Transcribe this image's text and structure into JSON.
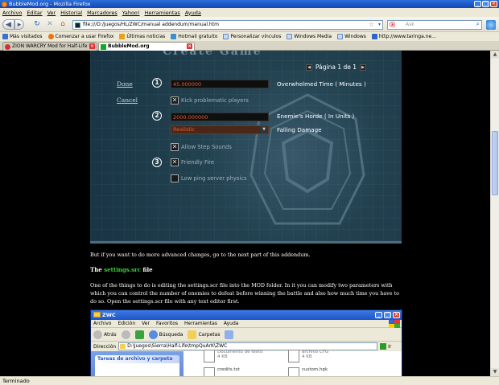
{
  "window": {
    "title": "BubbleMod.org - Mozilla Firefox"
  },
  "menubar": [
    "Archivo",
    "Editar",
    "Ver",
    "Historial",
    "Marcadores",
    "Yahoo!",
    "Herramientas",
    "Ayuda"
  ],
  "navbar": {
    "url": "file:///D:/Juegos/HL/ZWC/manual addendum/manual.htm",
    "search_placeholder": "Ask"
  },
  "bookmarks": [
    {
      "label": "Más visitados",
      "color": "#3b6fd0"
    },
    {
      "label": "Comenzar a usar Firefox",
      "color": "#e8741a"
    },
    {
      "label": "Últimas noticias",
      "color": "#e8a21a"
    },
    {
      "label": "Hotmail gratuito",
      "color": "#3b8fd0"
    },
    {
      "label": "Personalizar vínculos",
      "color": "#5a8ad0"
    },
    {
      "label": "Windows Media",
      "color": "#5a8ad0"
    },
    {
      "label": "Windows",
      "color": "#5a8ad0"
    },
    {
      "label": "http://www.taringa.ne...",
      "color": "#2f66c8"
    }
  ],
  "tabs": [
    {
      "label": "ZION WARCRY Mod for Half-Life E...",
      "active": false
    },
    {
      "label": "BubbleMod.org",
      "active": true
    }
  ],
  "game": {
    "title": "Create Game",
    "page_label": "Página 1 de 1",
    "side_done": "Done",
    "side_cancel": "Cancel",
    "num1": "1",
    "num2": "2",
    "num3": "3",
    "time_value": "45.000000",
    "time_label": "Overwhelmed Time ( Minutes )",
    "kick_label": "Kick problematic players",
    "horde_value": "2000.000000",
    "horde_label": "Enemie's Horde ( In Units )",
    "realism_value": "Realistic",
    "falling_label": "Falling Damage",
    "step_label": "Allow Step Sounds",
    "friendly_label": "Friendly Fire",
    "lowping_label": "Low ping server physics"
  },
  "body": {
    "para1": "But if you want to do more advanced changes, go to the next part of this addendum.",
    "heading_prefix": "The",
    "heading_file": "settings.src",
    "heading_suffix": "file",
    "para2": "One of the things to do is editing the settings.scr file into the MOD folder. In it you can modify two parameters with which you can control the number of enemies to defeat before winning the battle and also how much time you have to do so. Open the settings.scr file with any text editor first."
  },
  "explorer": {
    "title": "ZWC",
    "menu": [
      "Archivo",
      "Edición",
      "Ver",
      "Favoritos",
      "Herramientas",
      "Ayuda"
    ],
    "back": "Atrás",
    "search": "Búsqueda",
    "folders": "Carpetas",
    "address_label": "Dirección",
    "address_value": "D:\\Juegos\\Sierra\\Half-Life\\tmpQuArK\\ZWC",
    "go": "Ir",
    "tasks_header": "Tareas de archivo y carpeta",
    "files": [
      {
        "name": "Documento de texto",
        "size": "4 KB"
      },
      {
        "name": "archivo CFG",
        "size": "4 KB"
      },
      {
        "name": "credits.txt",
        "size": ""
      },
      {
        "name": "custom.hpk",
        "size": ""
      }
    ]
  },
  "status": "Terminado"
}
